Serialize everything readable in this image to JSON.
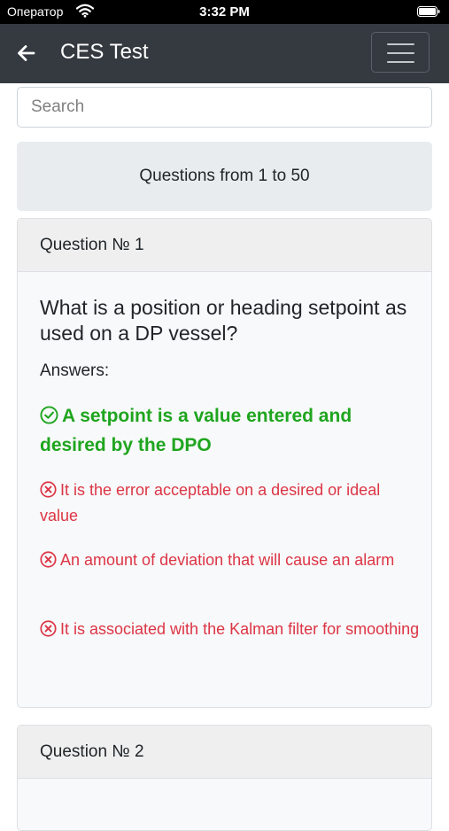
{
  "status_bar": {
    "carrier": "Оператор",
    "time": "3:32 PM"
  },
  "navbar": {
    "title": "CES Test"
  },
  "search": {
    "placeholder": "Search",
    "value": ""
  },
  "range": {
    "label": "Questions from 1 to 50"
  },
  "questions": [
    {
      "header": "Question № 1",
      "text": "What is a position or heading setpoint as used on a DP vessel?",
      "answers_label": "Answers:",
      "answers": [
        {
          "text": "A setpoint is a value entered and desired by the DPO",
          "correct": true
        },
        {
          "text": "It is the error acceptable on a desired or ideal value",
          "correct": false
        },
        {
          "text": "An amount of deviation that will cause an alarm",
          "correct": false
        },
        {
          "text": "It is associated with the Kalman filter for smoothing",
          "correct": false
        }
      ]
    },
    {
      "header": "Question № 2"
    }
  ],
  "colors": {
    "correct": "#1fa51f",
    "wrong": "#dc3545",
    "navbar": "#343a40"
  }
}
